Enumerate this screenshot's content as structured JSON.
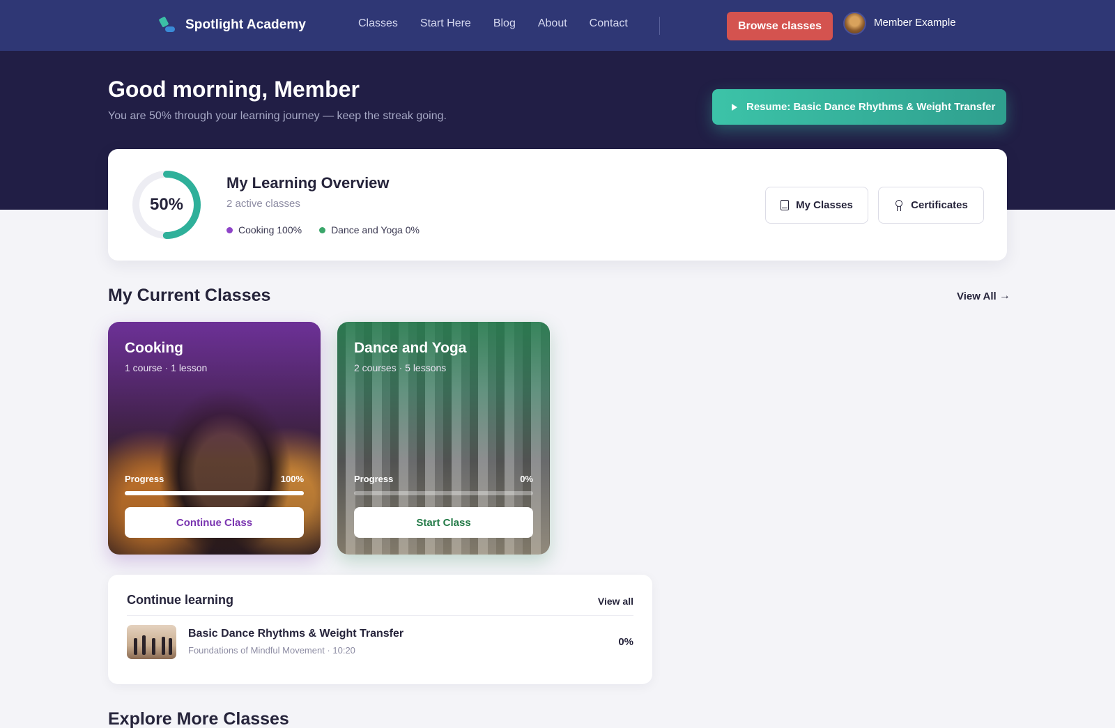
{
  "brand": {
    "name": "Spotlight Academy"
  },
  "nav": {
    "links": [
      "Classes",
      "Start Here",
      "Blog",
      "About",
      "Contact"
    ],
    "browse_label": "Browse classes",
    "member_name": "Member Example"
  },
  "hero": {
    "greeting": "Good morning, Member",
    "subtitle": "You are 50% through your learning journey — keep the streak going.",
    "resume_label": "Resume: Basic Dance Rhythms & Weight Transfer"
  },
  "overview": {
    "progress_percent": 50,
    "progress_label": "50%",
    "title": "My Learning Overview",
    "subtitle": "2 active classes",
    "legend": [
      {
        "label": "Cooking 100%",
        "color": "#8e44c8"
      },
      {
        "label": "Dance and Yoga 0%",
        "color": "#3aa66a"
      }
    ],
    "my_classes_label": "My Classes",
    "certificates_label": "Certificates",
    "ring_color": "#2fb09a"
  },
  "current_classes": {
    "title": "My Current Classes",
    "view_all_label": "View All",
    "cards": [
      {
        "title": "Cooking",
        "meta": "1 course · 1 lesson",
        "progress_label": "Progress",
        "progress_value": "100%",
        "progress": 100,
        "button_label": "Continue Class",
        "accent": "#7a35b0"
      },
      {
        "title": "Dance and Yoga",
        "meta": "2 courses · 5 lessons",
        "progress_label": "Progress",
        "progress_value": "0%",
        "progress": 0,
        "button_label": "Start Class",
        "accent": "#237a47"
      }
    ]
  },
  "continue_learning": {
    "title": "Continue learning",
    "view_all_label": "View all",
    "item": {
      "title": "Basic Dance Rhythms & Weight Transfer",
      "subtitle": "Foundations of Mindful Movement · 10:20",
      "progress": "0%"
    }
  },
  "explore": {
    "title": "Explore More Classes"
  }
}
